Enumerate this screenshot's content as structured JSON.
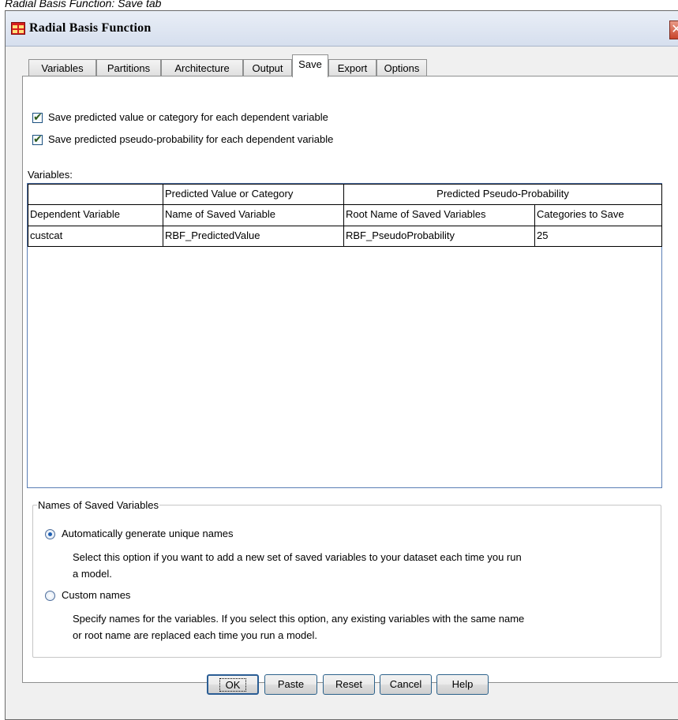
{
  "caption": "Radial Basis Function: Save tab",
  "window": {
    "title": "Radial Basis Function",
    "close_glyph": "✕"
  },
  "tabs": [
    "Variables",
    "Partitions",
    "Architecture",
    "Output",
    "Save",
    "Export",
    "Options"
  ],
  "active_tab": "Save",
  "checkboxes": {
    "save_predicted": {
      "label": "Save predicted value or category for each dependent variable",
      "checked": true
    },
    "save_pseudo": {
      "label": "Save predicted pseudo-probability for each dependent variable",
      "checked": true
    }
  },
  "variables_label": "Variables:",
  "table": {
    "group_headers": [
      "",
      "Predicted Value or Category",
      "Predicted Pseudo-Probability"
    ],
    "columns": [
      "Dependent Variable",
      "Name of Saved Variable",
      "Root Name of Saved Variables",
      "Categories to Save"
    ],
    "rows": [
      [
        "custcat",
        "RBF_PredictedValue",
        "RBF_PseudoProbability",
        "25"
      ]
    ]
  },
  "names_group": {
    "legend": "Names of Saved Variables",
    "auto": {
      "label": "Automatically generate unique names",
      "selected": true,
      "description_line1": "Select this option if you want to add a new set of saved variables to your dataset each time you run",
      "description_line2": "a model."
    },
    "custom": {
      "label": "Custom names",
      "selected": false,
      "description_line1": "Specify names for the variables. If you select this option, any existing variables with the same name",
      "description_line2": "or root name are replaced each time you run a model."
    }
  },
  "buttons": {
    "ok": "OK",
    "paste": "Paste",
    "reset": "Reset",
    "cancel": "Cancel",
    "help": "Help"
  },
  "colors": {
    "title_bg": "#d6dfee",
    "accent": "#1f5fb2",
    "close": "#c9452c",
    "table_border": "#5a7eb5"
  }
}
